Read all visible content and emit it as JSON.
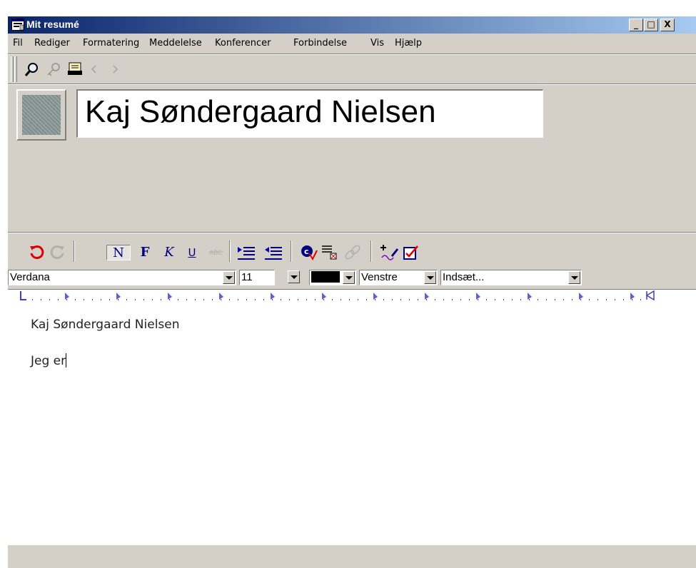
{
  "window": {
    "title": "Mit resumé"
  },
  "title_buttons": {
    "minimize": "_",
    "maximize": "□",
    "close": "X"
  },
  "menu": {
    "items": [
      "Fil",
      "Rediger",
      "Formatering",
      "Meddelelse",
      "Konferencer",
      "Forbindelse",
      "Vis",
      "Hjælp"
    ]
  },
  "toolbar": {
    "icons": [
      "magnifier-icon",
      "key-icon",
      "document-icon",
      "arrow-left-icon",
      "arrow-right-icon"
    ]
  },
  "header": {
    "name": "Kaj Søndergaard Nielsen"
  },
  "format_toolbar": {
    "bold_label": "N",
    "normal_label": "F",
    "italic_label": "K",
    "underline_label": "U",
    "icons": [
      "undo-icon",
      "redo-icon",
      "strikethrough-icon",
      "indent-icon",
      "outdent-icon",
      "spellcheck-icon",
      "align-icon",
      "link-icon",
      "insert-icon",
      "check-icon"
    ]
  },
  "combos": {
    "font": "Verdana",
    "size": "11",
    "color": "#000000",
    "align": "Venstre",
    "insert": "Indsæt..."
  },
  "editor": {
    "line1": "Kaj Søndergaard Nielsen",
    "line2": "Jeg er"
  }
}
